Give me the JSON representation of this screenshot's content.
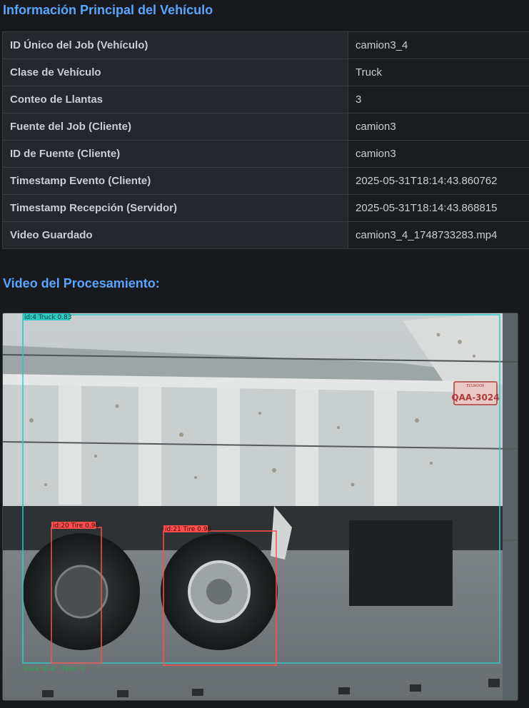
{
  "info_section": {
    "title": "Información Principal del Vehículo",
    "rows": [
      {
        "key": "ID Único del Job (Vehículo)",
        "value": "camion3_4"
      },
      {
        "key": "Clase de Vehículo",
        "value": "Truck"
      },
      {
        "key": "Conteo de Llantas",
        "value": "3"
      },
      {
        "key": "Fuente del Job (Cliente)",
        "value": "camion3"
      },
      {
        "key": "ID de Fuente (Cliente)",
        "value": "camion3"
      },
      {
        "key": "Timestamp Evento (Cliente)",
        "value": "2025-05-31T18:14:43.860762"
      },
      {
        "key": "Timestamp Recepción (Servidor)",
        "value": "2025-05-31T18:14:43.868815"
      },
      {
        "key": "Video Guardado",
        "value": "camion3_4_1748733283.mp4"
      }
    ]
  },
  "video_section": {
    "title": "Video del Procesamiento:",
    "truck_label": "id:4 Truck 0.83",
    "tire_labels": [
      "id:20 Tire 0.90",
      "id:21 Tire 0.93"
    ],
    "footer_label": "Truck ID 4 - Tires: 3",
    "plate_text": "QAA-3024",
    "plate_country": "ECUADOR",
    "colors": {
      "truck_box": "#2fc9c4",
      "tire_box": "#ff4d4d",
      "footer_text": "#22b14c",
      "accent": "#58a6ff"
    }
  }
}
